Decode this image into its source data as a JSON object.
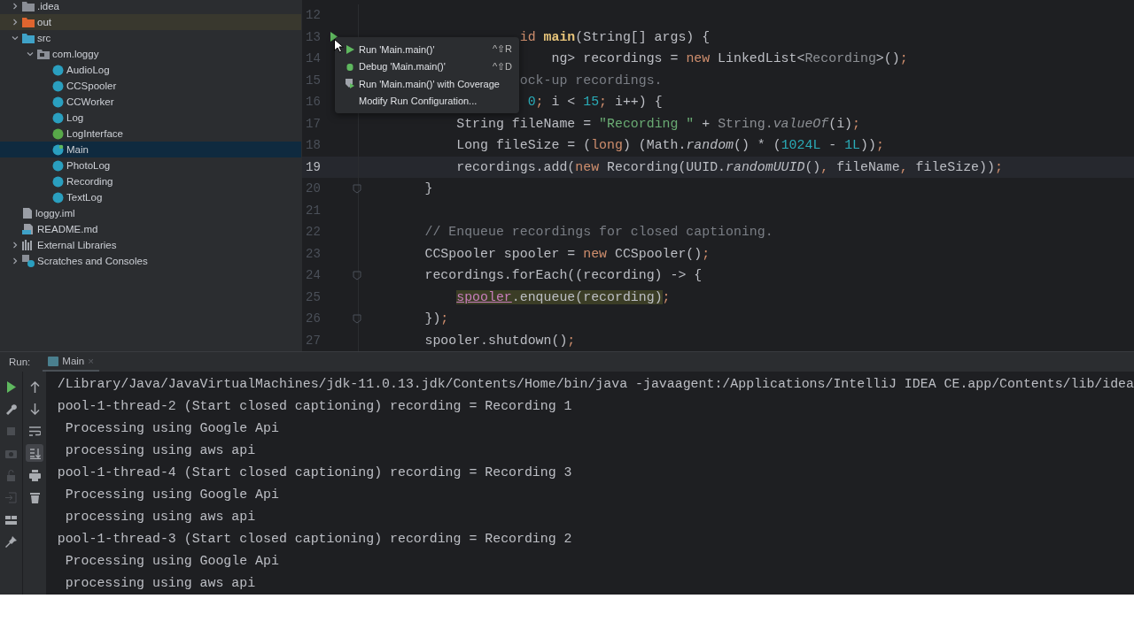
{
  "project_tree": [
    {
      "label": ".idea",
      "kind": "folder",
      "expanded": false,
      "selected": false
    },
    {
      "label": "out",
      "kind": "excluded",
      "expanded": false,
      "selected": false
    },
    {
      "label": "src",
      "kind": "source",
      "expanded": true,
      "selected": false,
      "children": [
        {
          "label": "com.loggy",
          "kind": "package",
          "expanded": true,
          "selected": false,
          "children": [
            {
              "label": "AudioLog",
              "kind": "class",
              "selected": false
            },
            {
              "label": "CCSpooler",
              "kind": "class",
              "selected": false
            },
            {
              "label": "CCWorker",
              "kind": "class",
              "selected": false
            },
            {
              "label": "Log",
              "kind": "abstract",
              "selected": false
            },
            {
              "label": "LogInterface",
              "kind": "interface",
              "selected": false
            },
            {
              "label": "Main",
              "kind": "main",
              "selected": true
            },
            {
              "label": "PhotoLog",
              "kind": "class",
              "selected": false
            },
            {
              "label": "Recording",
              "kind": "class",
              "selected": false
            },
            {
              "label": "TextLog",
              "kind": "class",
              "selected": false
            }
          ]
        }
      ]
    },
    {
      "label": "loggy.iml",
      "kind": "iml",
      "selected": false
    },
    {
      "label": "README.md",
      "kind": "markdown",
      "selected": false
    },
    {
      "label": "External Libraries",
      "kind": "libraries",
      "expanded": false,
      "selected": false
    },
    {
      "label": "Scratches and Consoles",
      "kind": "scratches",
      "expanded": false,
      "selected": false
    }
  ],
  "editor": {
    "lines": [
      {
        "number": "12",
        "current": false,
        "kind": "plain"
      },
      {
        "number": "13",
        "current": false,
        "kind": "run",
        "tokens": [
          {
            "text": "                    id",
            "kind": "keyword"
          },
          {
            "text": " main",
            "kind": "method"
          },
          {
            "text": "(String[] args) {",
            "kind": "plain"
          }
        ]
      },
      {
        "number": "14",
        "current": false,
        "tokens": [
          {
            "text": "                        ng> recordings = ",
            "kind": "plain"
          },
          {
            "text": "new",
            "kind": "keyword"
          },
          {
            "text": " LinkedList<",
            "kind": "plain"
          },
          {
            "text": "Recording",
            "kind": "muted"
          },
          {
            "text": ">()",
            "kind": "plain"
          },
          {
            "text": ";",
            "kind": "keyword"
          }
        ]
      },
      {
        "number": "15",
        "current": false,
        "tokens": [
          {
            "text": "                    ock-up recordings.",
            "kind": "comment"
          }
        ]
      },
      {
        "number": "16",
        "current": false,
        "tokens": [
          {
            "text": "                     0",
            "kind": "number"
          },
          {
            "text": ";",
            "kind": "keyword"
          },
          {
            "text": " i < ",
            "kind": "plain"
          },
          {
            "text": "15",
            "kind": "number"
          },
          {
            "text": ";",
            "kind": "keyword"
          },
          {
            "text": " i++) {",
            "kind": "plain"
          }
        ]
      },
      {
        "number": "17",
        "current": false,
        "tokens": [
          {
            "text": "            String fileName = ",
            "kind": "plain"
          },
          {
            "text": "\"Recording \"",
            "kind": "string"
          },
          {
            "text": " + ",
            "kind": "plain"
          },
          {
            "text": "String.",
            "kind": "muted"
          },
          {
            "text": "valueOf",
            "kind": "faint"
          },
          {
            "text": "(i)",
            "kind": "plain"
          },
          {
            "text": ";",
            "kind": "keyword"
          }
        ]
      },
      {
        "number": "18",
        "current": false,
        "tokens": [
          {
            "text": "            Long fileSize = (",
            "kind": "plain"
          },
          {
            "text": "long",
            "kind": "keyword"
          },
          {
            "text": ") (Math.",
            "kind": "plain"
          },
          {
            "text": "random",
            "kind": "italic"
          },
          {
            "text": "() * (",
            "kind": "plain"
          },
          {
            "text": "1024L",
            "kind": "number"
          },
          {
            "text": " - ",
            "kind": "plain"
          },
          {
            "text": "1L",
            "kind": "number"
          },
          {
            "text": "))",
            "kind": "plain"
          },
          {
            "text": ";",
            "kind": "keyword"
          }
        ]
      },
      {
        "number": "19",
        "current": true,
        "tokens": [
          {
            "text": "            recordings.add(",
            "kind": "plain"
          },
          {
            "text": "new",
            "kind": "keyword"
          },
          {
            "text": " Recording(UUID.",
            "kind": "plain"
          },
          {
            "text": "randomUUID",
            "kind": "italic"
          },
          {
            "text": "()",
            "kind": "plain"
          },
          {
            "text": ",",
            "kind": "keyword"
          },
          {
            "text": " fileName",
            "kind": "plain"
          },
          {
            "text": ",",
            "kind": "keyword"
          },
          {
            "text": " fileSize))",
            "kind": "plain"
          },
          {
            "text": ";",
            "kind": "keyword"
          }
        ]
      },
      {
        "number": "20",
        "current": false,
        "kind": "fold",
        "tokens": [
          {
            "text": "        }",
            "kind": "plain"
          }
        ]
      },
      {
        "number": "21",
        "current": false,
        "kind": "plain"
      },
      {
        "number": "22",
        "current": false,
        "tokens": [
          {
            "text": "        // Enqueue recordings for closed captioning.",
            "kind": "comment"
          }
        ]
      },
      {
        "number": "23",
        "current": false,
        "tokens": [
          {
            "text": "        CCSpooler spooler = ",
            "kind": "plain"
          },
          {
            "text": "new",
            "kind": "keyword"
          },
          {
            "text": " CCSpooler()",
            "kind": "plain"
          },
          {
            "text": ";",
            "kind": "keyword"
          }
        ]
      },
      {
        "number": "24",
        "current": false,
        "kind": "fold",
        "tokens": [
          {
            "text": "        recordings.forEach((recording) -> {",
            "kind": "plain"
          }
        ]
      },
      {
        "number": "25",
        "current": false,
        "tokens": [
          {
            "text": "            spooler",
            "kind": "field"
          },
          {
            "text": ".enqueue(recording)",
            "kind": "marked"
          },
          {
            "text": ";",
            "kind": "keyword"
          }
        ]
      },
      {
        "number": "26",
        "current": false,
        "kind": "fold",
        "tokens": [
          {
            "text": "        })",
            "kind": "plain"
          },
          {
            "text": ";",
            "kind": "keyword"
          }
        ]
      },
      {
        "number": "27",
        "current": false,
        "tokens": [
          {
            "text": "        spooler.shutdown()",
            "kind": "plain"
          },
          {
            "text": ";",
            "kind": "keyword"
          }
        ]
      }
    ],
    "run_menu": [
      {
        "kind": "run",
        "label": "Run 'Main.main()'",
        "shortcut": "^⇧R"
      },
      {
        "kind": "debug",
        "label": "Debug 'Main.main()'",
        "shortcut": "^⇧D"
      },
      {
        "kind": "coverage",
        "label": "Run 'Main.main()' with Coverage"
      },
      {
        "kind": "plain",
        "label": "Modify Run Configuration..."
      }
    ]
  },
  "run_panel": {
    "title": "Run:",
    "tab": {
      "label": "Main",
      "close": "×",
      "selected": true
    },
    "left_tools": [
      {
        "kind": "run",
        "disabled": false
      },
      {
        "kind": "wrench",
        "disabled": false
      },
      {
        "kind": "stop",
        "disabled": true
      },
      {
        "kind": "camera",
        "disabled": true
      },
      {
        "kind": "export",
        "disabled": true
      },
      {
        "kind": "exit",
        "disabled": true
      },
      {
        "kind": "layout",
        "disabled": false
      },
      {
        "kind": "pin",
        "disabled": false
      }
    ],
    "right_tools": [
      {
        "kind": "up",
        "selected": false
      },
      {
        "kind": "down",
        "selected": false
      },
      {
        "kind": "wrap",
        "selected": false
      },
      {
        "kind": "scroll",
        "selected": true
      },
      {
        "kind": "print",
        "selected": false
      },
      {
        "kind": "trash",
        "selected": false
      }
    ],
    "console": [
      "/Library/Java/JavaVirtualMachines/jdk-11.0.13.jdk/Contents/Home/bin/java -javaagent:/Applications/IntelliJ IDEA CE.app/Contents/lib/idea",
      "pool-1-thread-2 (Start closed captioning) recording = Recording 1",
      " Processing using Google Api",
      " processing using aws api",
      "pool-1-thread-4 (Start closed captioning) recording = Recording 3",
      " Processing using Google Api",
      " processing using aws api",
      "pool-1-thread-3 (Start closed captioning) recording = Recording 2",
      " Processing using Google Api",
      " processing using aws api"
    ]
  }
}
